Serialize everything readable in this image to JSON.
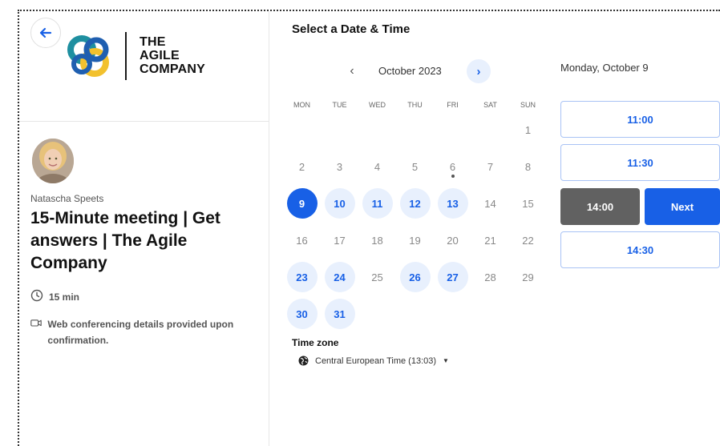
{
  "brand": {
    "logo_line1": "THE",
    "logo_line2": "AGILE",
    "logo_line3": "COMPANY",
    "colors": {
      "blue": "#1f5fb0",
      "yellow": "#f2c12e",
      "teal": "#1e8fa0"
    }
  },
  "navigation": {
    "back_icon": "arrow-left-icon"
  },
  "host": {
    "name": "Natascha Speets",
    "event_title": "15-Minute meeting | Get answers | The Agile Company",
    "duration": "15 min",
    "conferencing": "Web conferencing details provided upon confirmation."
  },
  "scheduler": {
    "title": "Select a Date & Time",
    "month": "October 2023",
    "weekdays": [
      "MON",
      "TUE",
      "WED",
      "THU",
      "FRI",
      "SAT",
      "SUN"
    ],
    "days": [
      {
        "n": "",
        "state": "empty"
      },
      {
        "n": "",
        "state": "empty"
      },
      {
        "n": "",
        "state": "empty"
      },
      {
        "n": "",
        "state": "empty"
      },
      {
        "n": "",
        "state": "empty"
      },
      {
        "n": "",
        "state": "empty"
      },
      {
        "n": "1",
        "state": "disabled"
      },
      {
        "n": "2",
        "state": "disabled"
      },
      {
        "n": "3",
        "state": "disabled"
      },
      {
        "n": "4",
        "state": "disabled"
      },
      {
        "n": "5",
        "state": "disabled"
      },
      {
        "n": "6",
        "state": "today"
      },
      {
        "n": "7",
        "state": "disabled"
      },
      {
        "n": "8",
        "state": "disabled"
      },
      {
        "n": "9",
        "state": "selected"
      },
      {
        "n": "10",
        "state": "available"
      },
      {
        "n": "11",
        "state": "available"
      },
      {
        "n": "12",
        "state": "available"
      },
      {
        "n": "13",
        "state": "available"
      },
      {
        "n": "14",
        "state": "disabled"
      },
      {
        "n": "15",
        "state": "disabled"
      },
      {
        "n": "16",
        "state": "disabled"
      },
      {
        "n": "17",
        "state": "disabled"
      },
      {
        "n": "18",
        "state": "disabled"
      },
      {
        "n": "19",
        "state": "disabled"
      },
      {
        "n": "20",
        "state": "disabled"
      },
      {
        "n": "21",
        "state": "disabled"
      },
      {
        "n": "22",
        "state": "disabled"
      },
      {
        "n": "23",
        "state": "available"
      },
      {
        "n": "24",
        "state": "available"
      },
      {
        "n": "25",
        "state": "disabled"
      },
      {
        "n": "26",
        "state": "available"
      },
      {
        "n": "27",
        "state": "available"
      },
      {
        "n": "28",
        "state": "disabled"
      },
      {
        "n": "29",
        "state": "disabled"
      },
      {
        "n": "30",
        "state": "available"
      },
      {
        "n": "31",
        "state": "available"
      }
    ],
    "timezone_label": "Time zone",
    "timezone_value": "Central European Time (13:03)",
    "selected_date": "Monday, October 9",
    "slots": [
      "11:00",
      "11:30",
      "14:00",
      "14:30"
    ],
    "selected_slot": "14:00",
    "next_label": "Next",
    "accent": "#1860e6",
    "accent_soft": "#e8f0fd"
  }
}
